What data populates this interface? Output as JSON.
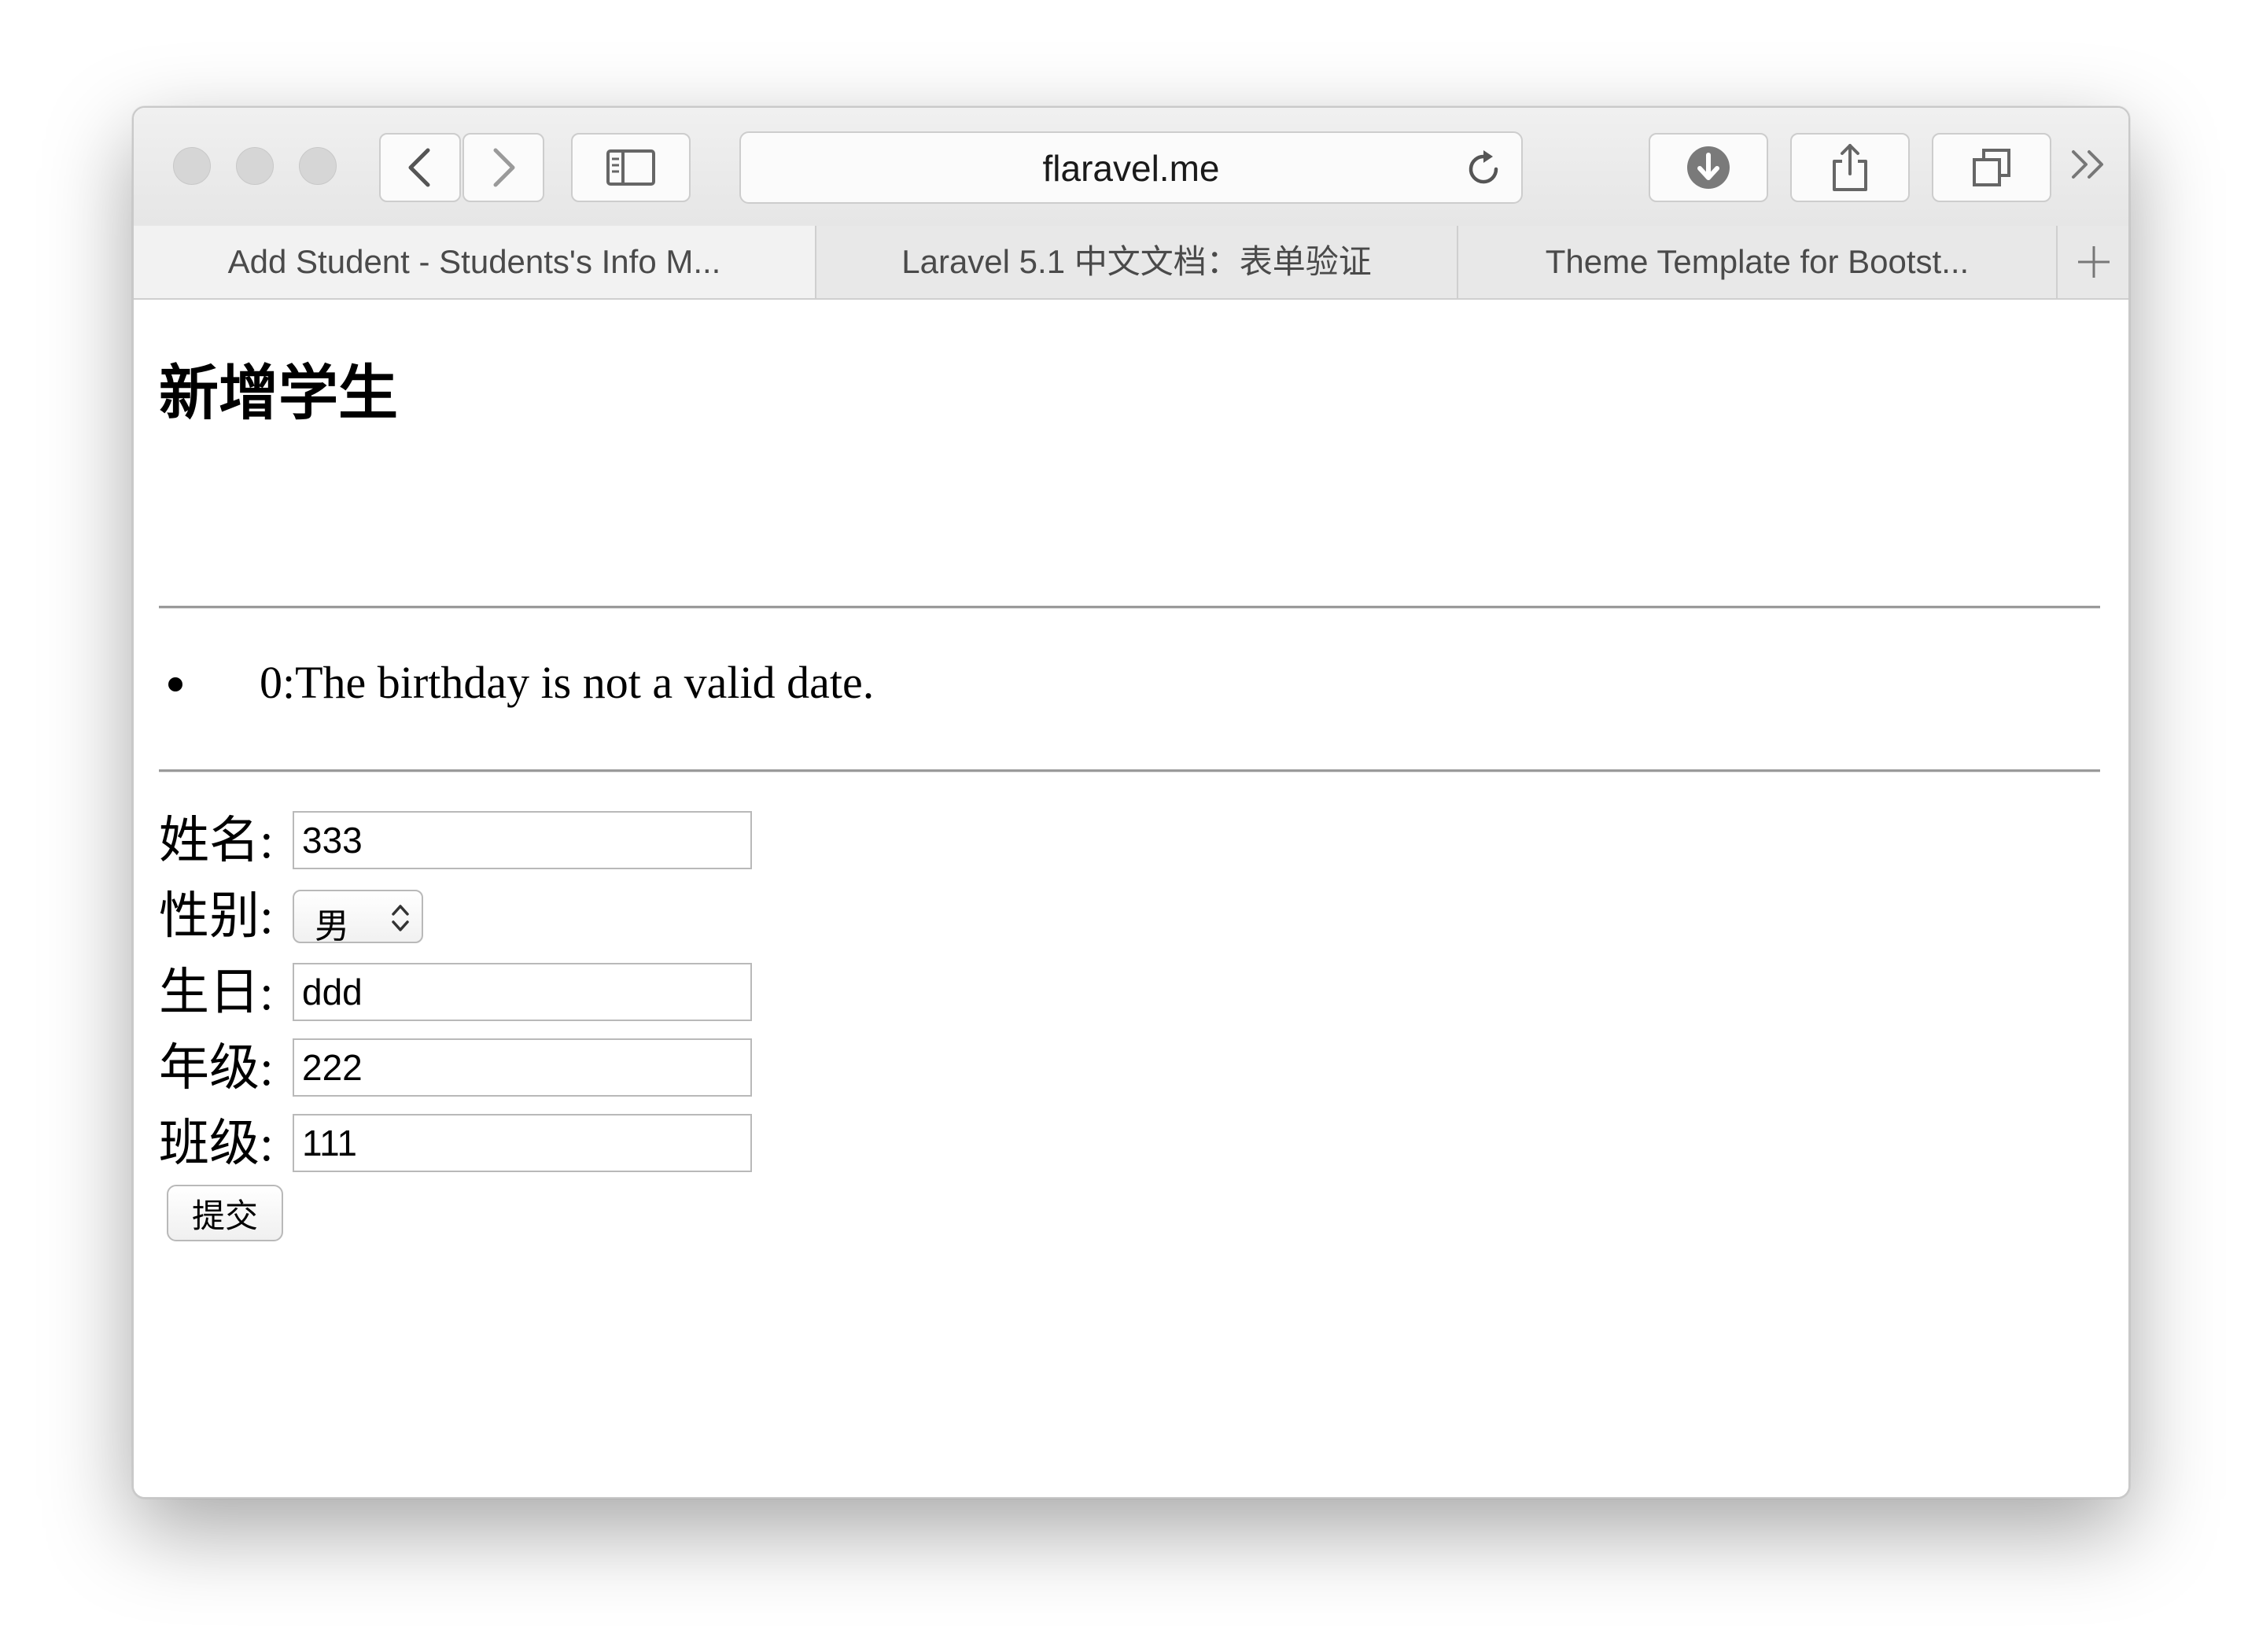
{
  "browser": {
    "url": "flaravel.me",
    "tabs": [
      {
        "title": "Add Student - Students's Info M..."
      },
      {
        "title": "Laravel 5.1 中文文档：表单验证"
      },
      {
        "title": "Theme Template for Bootst..."
      }
    ],
    "icons": {
      "back": "chevron-left-icon",
      "forward": "chevron-right-icon",
      "sidebar": "sidebar-icon",
      "reload": "reload-icon",
      "download": "download-icon",
      "share": "share-icon",
      "tabs": "tabs-overview-icon",
      "overflow": "double-chevron-right-icon",
      "new_tab": "plus-icon"
    }
  },
  "page": {
    "title": "新增学生",
    "errors": [
      "0:The birthday is not a valid date."
    ],
    "form": {
      "name": {
        "label": "姓名:",
        "value": "333"
      },
      "gender": {
        "label": "性别:",
        "selected": "男"
      },
      "birthday": {
        "label": "生日:",
        "value": "ddd"
      },
      "grade": {
        "label": "年级:",
        "value": "222"
      },
      "class": {
        "label": "班级:",
        "value": "111"
      },
      "submit_label": "提交"
    }
  }
}
